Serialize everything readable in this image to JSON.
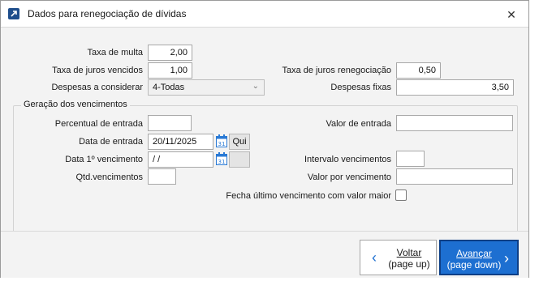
{
  "window": {
    "title": "Dados para renegociação de dívidas",
    "close_glyph": "✕"
  },
  "form": {
    "taxa_multa": {
      "label": "Taxa de multa",
      "value": "2,00"
    },
    "taxa_juros_vencidos": {
      "label": "Taxa de juros vencidos",
      "value": "1,00"
    },
    "despesas_considerar": {
      "label": "Despesas a considerar",
      "value": "4-Todas"
    },
    "taxa_juros_renegociacao": {
      "label": "Taxa de juros renegociação",
      "value": "0,50"
    },
    "despesas_fixas": {
      "label": "Despesas fixas",
      "value": "3,50"
    }
  },
  "group": {
    "title": "Geração dos vencimentos",
    "percentual_entrada": {
      "label": "Percentual de entrada",
      "value": ""
    },
    "valor_entrada": {
      "label": "Valor de entrada",
      "value": ""
    },
    "data_entrada": {
      "label": "Data de entrada",
      "value": "20/11/2025",
      "weekday": "Qui"
    },
    "data_1_vencimento": {
      "label": "Data 1º vencimento",
      "value": " /  /",
      "weekday": ""
    },
    "intervalo_vencimentos": {
      "label": "Intervalo vencimentos",
      "value": ""
    },
    "qtd_vencimentos": {
      "label": "Qtd.vencimentos",
      "value": ""
    },
    "valor_por_vencimento": {
      "label": "Valor por vencimento",
      "value": ""
    },
    "fecha_ultimo": {
      "label": "Fecha último vencimento com valor maior",
      "checked": false
    }
  },
  "footer": {
    "back": {
      "line1": "Voltar",
      "line2": "(page up)"
    },
    "next": {
      "line1": "Avançar",
      "line2": "(page down)"
    }
  },
  "icons": {
    "app": "arrow-up-right-icon",
    "calendar": "calendar-icon",
    "back": "chevron-left-icon",
    "next": "chevron-right-icon"
  },
  "colors": {
    "accent": "#1d6fd1",
    "calendar_blue": "#2a7ad5"
  }
}
